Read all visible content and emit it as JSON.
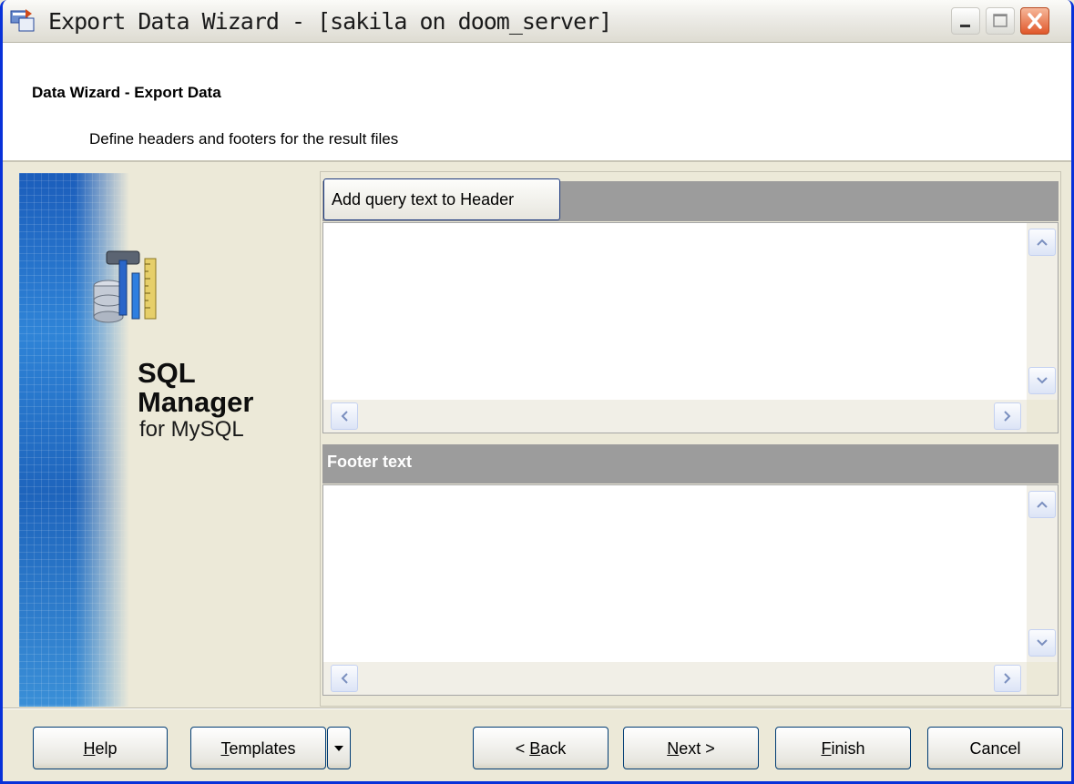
{
  "window": {
    "title": "Export Data Wizard - [sakila on doom_server]"
  },
  "header": {
    "title": "Data Wizard - Export Data",
    "subtitle": "Define headers and footers for the result files"
  },
  "banner": {
    "product_line1": "SQL",
    "product_line2": "Manager",
    "product_for": "for MySQL"
  },
  "editor": {
    "add_query_button": "Add query text to Header",
    "header_text": "",
    "footer_label": "Footer text",
    "footer_text": ""
  },
  "buttons": {
    "help": {
      "accel": "H",
      "rest": "elp"
    },
    "templates": {
      "accel": "T",
      "rest": "emplates"
    },
    "back": {
      "pre": "< ",
      "accel": "B",
      "rest": "ack"
    },
    "next": {
      "accel": "N",
      "rest": "ext >"
    },
    "finish": {
      "accel": "F",
      "rest": "inish"
    },
    "cancel": "Cancel"
  },
  "colors": {
    "title_bar_border": "#0831d9",
    "close_button": "#e0582b",
    "panel_bar": "#9c9c9c",
    "background": "#ece9d8"
  },
  "icons": [
    "app-icon",
    "minimize-icon",
    "maximize-icon",
    "close-icon",
    "product-icon",
    "arrow-up-icon",
    "arrow-down-icon",
    "arrow-left-icon",
    "arrow-right-icon",
    "dropdown-arrow-icon"
  ]
}
